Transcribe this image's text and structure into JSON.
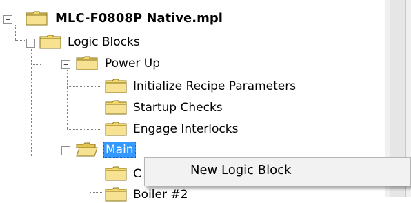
{
  "tree": {
    "root": "MLC-F0808P Native.mpl",
    "logic_blocks": "Logic Blocks",
    "power_up": "Power Up",
    "power_up_children": [
      "Initialize Recipe Parameters",
      "Startup Checks",
      "Engage Interlocks"
    ],
    "main": "Main",
    "main_child_partial": "C",
    "boiler_partial": "Boiler #2",
    "expander_collapse": "−"
  },
  "context_menu": {
    "items": [
      "New Logic Block"
    ]
  },
  "colors": {
    "selection": "#3399ff",
    "folder": "#f2d76b"
  },
  "icons": [
    "folder-icon",
    "open-folder-icon",
    "collapse-icon"
  ]
}
